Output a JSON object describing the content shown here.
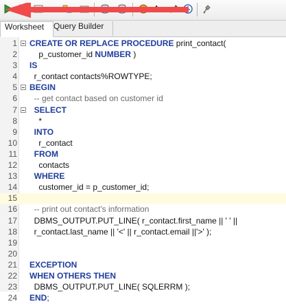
{
  "tabs": [
    {
      "label": "Worksheet",
      "active": true
    },
    {
      "label": "Query Builder",
      "active": false
    }
  ],
  "toolbar": {
    "font_button_label": "Aa",
    "icons": [
      "run-icon",
      "document-icon",
      "run-script-icon",
      "explain-icon",
      "autotrace-icon",
      "commit-icon",
      "rollback-icon",
      "unshared-icon",
      "format-icon",
      "clear-icon",
      "history-icon",
      "tuning-icon"
    ],
    "colors": {
      "run": "#2e9b2e",
      "arrow": "#f04a4a"
    }
  },
  "editor": {
    "current_line": 15,
    "lines": [
      {
        "n": "1",
        "fold": true,
        "parts": [
          {
            "t": "CREATE OR REPLACE PROCEDURE",
            "k": "kw"
          },
          {
            "t": " print_contact(",
            "k": ""
          }
        ]
      },
      {
        "n": "2",
        "fold": false,
        "parts": [
          {
            "t": "    p_customer_id ",
            "k": ""
          },
          {
            "t": "NUMBER",
            "k": "kw"
          },
          {
            "t": " )",
            "k": ""
          }
        ]
      },
      {
        "n": "3",
        "fold": false,
        "parts": [
          {
            "t": "IS",
            "k": "kw"
          }
        ]
      },
      {
        "n": "4",
        "fold": false,
        "parts": [
          {
            "t": "  r_contact contacts%ROWTYPE;",
            "k": ""
          }
        ]
      },
      {
        "n": "5",
        "fold": true,
        "parts": [
          {
            "t": "BEGIN",
            "k": "kw"
          }
        ]
      },
      {
        "n": "6",
        "fold": false,
        "parts": [
          {
            "t": "  -- get contact based on customer id",
            "k": "cm"
          }
        ]
      },
      {
        "n": "7",
        "fold": true,
        "parts": [
          {
            "t": "  ",
            "k": ""
          },
          {
            "t": "SELECT",
            "k": "kw"
          }
        ]
      },
      {
        "n": "8",
        "fold": false,
        "parts": [
          {
            "t": "    *",
            "k": ""
          }
        ]
      },
      {
        "n": "9",
        "fold": false,
        "parts": [
          {
            "t": "  ",
            "k": ""
          },
          {
            "t": "INTO",
            "k": "kw"
          }
        ]
      },
      {
        "n": "10",
        "fold": false,
        "parts": [
          {
            "t": "    r_contact",
            "k": ""
          }
        ]
      },
      {
        "n": "11",
        "fold": false,
        "parts": [
          {
            "t": "  ",
            "k": ""
          },
          {
            "t": "FROM",
            "k": "kw"
          }
        ]
      },
      {
        "n": "12",
        "fold": false,
        "parts": [
          {
            "t": "    contacts",
            "k": ""
          }
        ]
      },
      {
        "n": "13",
        "fold": false,
        "parts": [
          {
            "t": "  ",
            "k": ""
          },
          {
            "t": "WHERE",
            "k": "kw"
          }
        ]
      },
      {
        "n": "14",
        "fold": false,
        "parts": [
          {
            "t": "    customer_id = p_customer_id;",
            "k": ""
          }
        ]
      },
      {
        "n": "15",
        "fold": false,
        "parts": []
      },
      {
        "n": "16",
        "fold": false,
        "parts": [
          {
            "t": "  -- print out contact's information",
            "k": "cm"
          }
        ]
      },
      {
        "n": "17",
        "fold": false,
        "parts": [
          {
            "t": "  DBMS_OUTPUT.PUT_LINE( r_contact.first_name || ' ' ||",
            "k": ""
          }
        ]
      },
      {
        "n": "18",
        "fold": false,
        "parts": [
          {
            "t": "  r_contact.last_name || '<' || r_contact.email ||'>' );",
            "k": ""
          }
        ]
      },
      {
        "n": "19",
        "fold": false,
        "parts": []
      },
      {
        "n": "20",
        "fold": false,
        "parts": []
      },
      {
        "n": "21",
        "fold": false,
        "parts": [
          {
            "t": "EXCEPTION",
            "k": "kw"
          }
        ]
      },
      {
        "n": "22",
        "fold": false,
        "parts": [
          {
            "t": "WHEN OTHERS THEN",
            "k": "kw"
          }
        ]
      },
      {
        "n": "23",
        "fold": false,
        "parts": [
          {
            "t": "  DBMS_OUTPUT.PUT_LINE( SQLERRM );",
            "k": ""
          }
        ]
      },
      {
        "n": "24",
        "fold": false,
        "parts": [
          {
            "t": "END",
            "k": "kw"
          },
          {
            "t": ";",
            "k": ""
          }
        ]
      }
    ]
  }
}
